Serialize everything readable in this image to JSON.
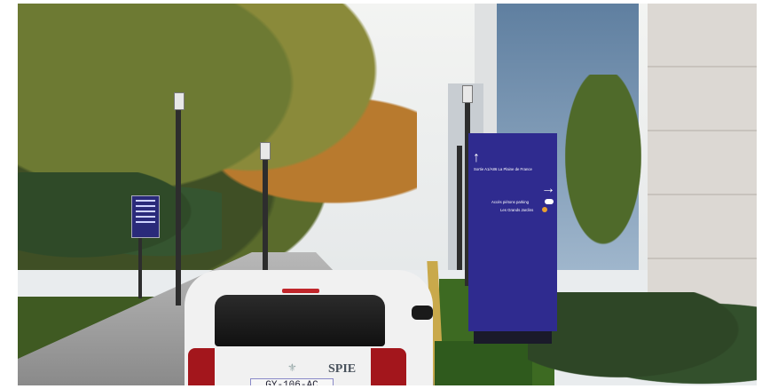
{
  "sign": {
    "line1": "Sortie A1/A86 La Plaine de France",
    "line2": "Accès piétons parking",
    "line3": "Les Grands Jardins",
    "arrow_up": "↑",
    "arrow_right": "→",
    "color": "#2f2b8f"
  },
  "car": {
    "plate": "GY-106-AC",
    "brand": "SPIE",
    "color": "#f1f1f1"
  },
  "icons": {
    "pedestrian": "pedestrian-parking-icon",
    "garden": "garden-icon"
  }
}
